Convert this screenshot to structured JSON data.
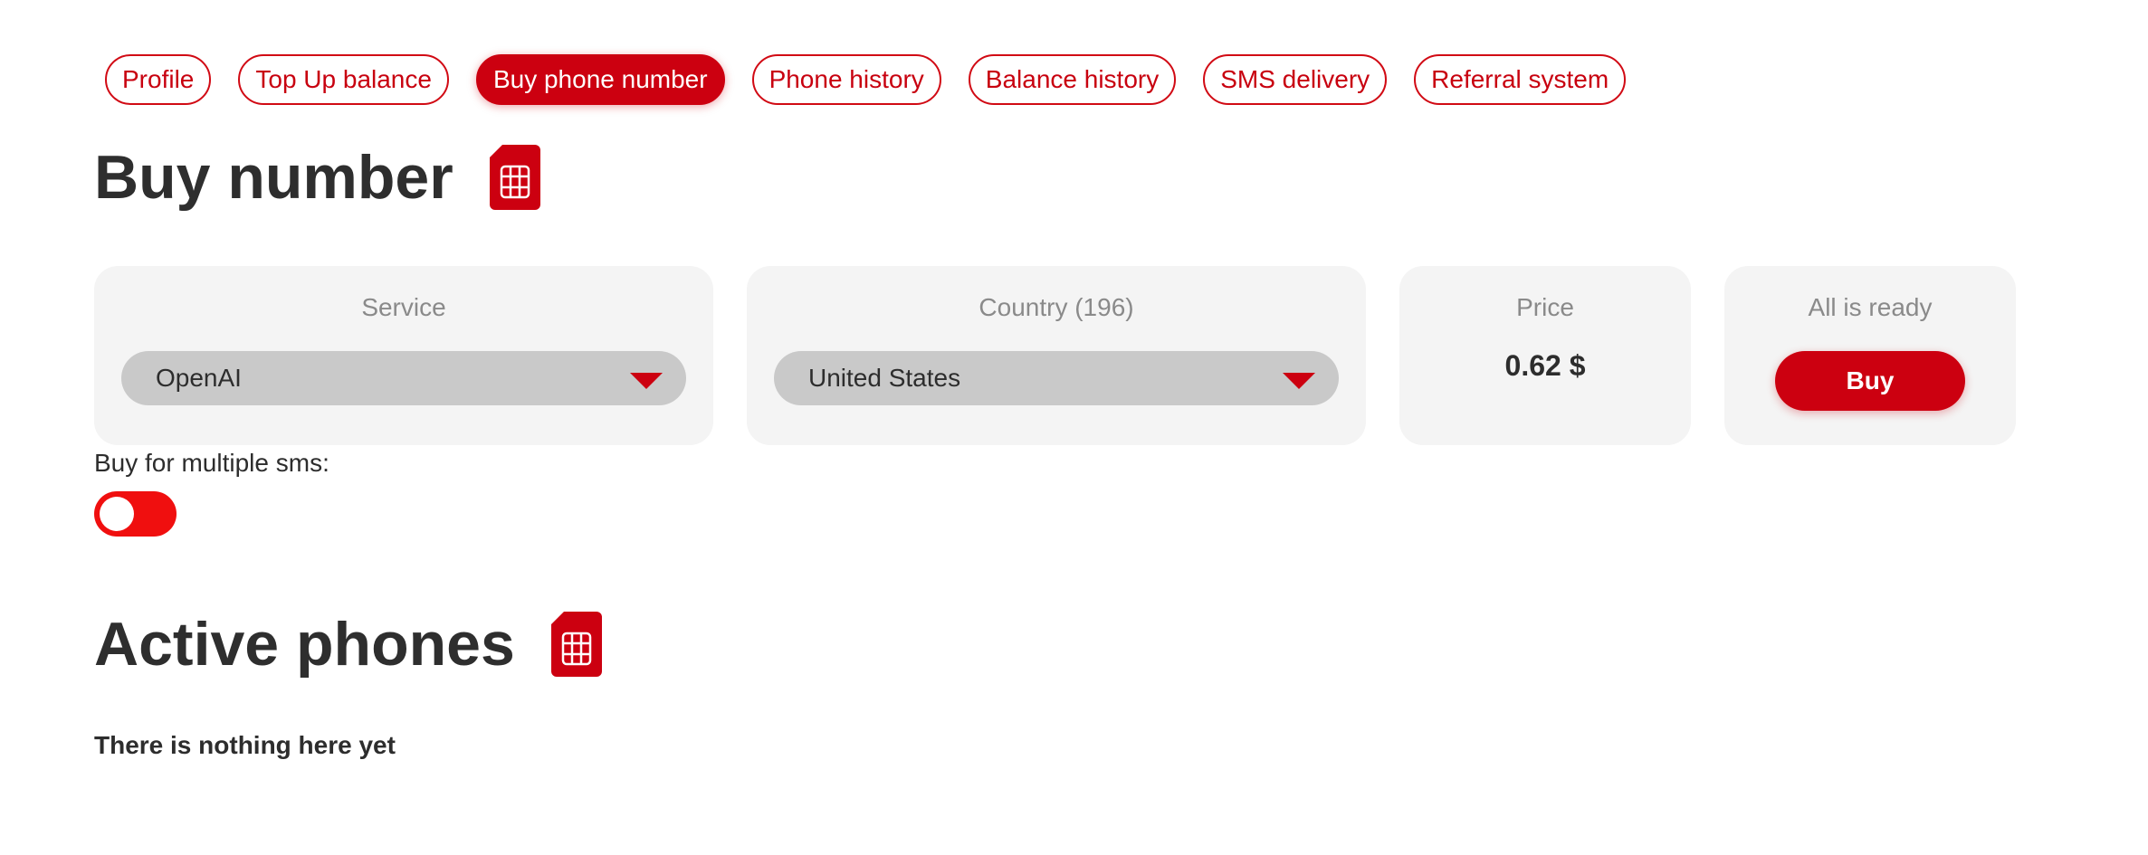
{
  "nav": {
    "tabs": [
      {
        "label": "Profile"
      },
      {
        "label": "Top Up balance"
      },
      {
        "label": "Buy phone number"
      },
      {
        "label": "Phone history"
      },
      {
        "label": "Balance history"
      },
      {
        "label": "SMS delivery"
      },
      {
        "label": "Referral system"
      }
    ],
    "active_tab": "Buy phone number"
  },
  "buy_section": {
    "title": "Buy number",
    "icon": "sim-card-icon",
    "service": {
      "label": "Service",
      "selected": "OpenAI"
    },
    "country": {
      "label": "Country (196)",
      "selected": "United States"
    },
    "price": {
      "label": "Price",
      "value": "0.62 $"
    },
    "ready": {
      "label": "All is ready",
      "button_label": "Buy"
    },
    "multiple_sms": {
      "label": "Buy for multiple sms:",
      "enabled": false
    }
  },
  "active_section": {
    "title": "Active phones",
    "icon": "sim-card-icon",
    "empty_text": "There is nothing here yet"
  },
  "colors": {
    "accent": "#cc0010",
    "toggle": "#f00f0f",
    "card_bg": "#f4f4f4",
    "select_bg": "#c9c9c9"
  }
}
